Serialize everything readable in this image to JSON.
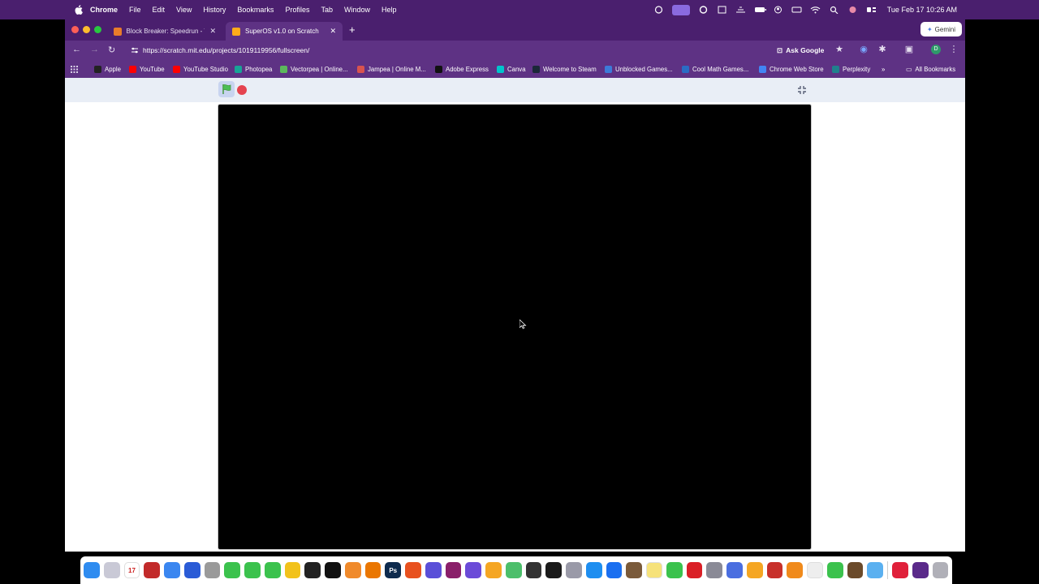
{
  "menubar": {
    "apple": "",
    "items": [
      "Chrome",
      "File",
      "Edit",
      "View",
      "History",
      "Bookmarks",
      "Profiles",
      "Tab",
      "Window",
      "Help"
    ],
    "clock": "Tue Feb 17  10:26 AM"
  },
  "browser": {
    "tabs": [
      {
        "title": "Block Breaker: Speedrun - Tu",
        "favicon_color": "#e87c2a"
      },
      {
        "title": "SuperOS v1.0 on Scratch",
        "favicon_color": "#ffab19"
      }
    ],
    "new_tab": "+",
    "gemini_label": "Gemini",
    "url": "https://scratch.mit.edu/projects/1019119956/fullscreen/",
    "ask_google": "Ask Google",
    "profile_initial": "D",
    "bookmarks": [
      {
        "label": "Apple",
        "color": "#222222"
      },
      {
        "label": "YouTube",
        "color": "#ff0000"
      },
      {
        "label": "YouTube Studio",
        "color": "#ff0000"
      },
      {
        "label": "Photopea",
        "color": "#18a497"
      },
      {
        "label": "Vectorpea | Online...",
        "color": "#5cb85c"
      },
      {
        "label": "Jampea | Online M...",
        "color": "#d9534f"
      },
      {
        "label": "Adobe Express",
        "color": "#111111"
      },
      {
        "label": "Canva",
        "color": "#00c4cc"
      },
      {
        "label": "Welcome to Steam",
        "color": "#1b2838"
      },
      {
        "label": "Unblocked Games...",
        "color": "#3d7bd9"
      },
      {
        "label": "Cool Math Games...",
        "color": "#2a6cc4"
      },
      {
        "label": "Chrome Web Store",
        "color": "#4285f4"
      },
      {
        "label": "Perplexity",
        "color": "#20808d"
      }
    ],
    "all_bookmarks": "All Bookmarks"
  },
  "scratch": {
    "green_flag": "green-flag-icon",
    "stop": "stop-icon",
    "exit_fullscreen": "exit-fullscreen-icon"
  },
  "dock": {
    "apps": [
      {
        "name": "Finder",
        "color": "#2f8cf0"
      },
      {
        "name": "Launchpad",
        "color": "#c9c9d6"
      },
      {
        "name": "Calendar",
        "color": "#ffffff",
        "label": "17"
      },
      {
        "name": "Notes",
        "color": "#c22a2a"
      },
      {
        "name": "Safari",
        "color": "#3a86f0"
      },
      {
        "name": "Xcode",
        "color": "#2a5bd6"
      },
      {
        "name": "Contacts",
        "color": "#9a9a9a"
      },
      {
        "name": "FaceTime",
        "color": "#3bc24d"
      },
      {
        "name": "Messages",
        "color": "#3bc24d"
      },
      {
        "name": "Phone",
        "color": "#3bc24d"
      },
      {
        "name": "Chrome",
        "color": "#f2c21b"
      },
      {
        "name": "ChatGPT",
        "color": "#222222"
      },
      {
        "name": "CapCut",
        "color": "#111111"
      },
      {
        "name": "Photos",
        "color": "#f08a2b"
      },
      {
        "name": "Blender",
        "color": "#ea7600"
      },
      {
        "name": "Photoshop",
        "color": "#0d2a4d",
        "label": "Ps"
      },
      {
        "name": "Office",
        "color": "#e8511f"
      },
      {
        "name": "iMovie",
        "color": "#5a4fd8"
      },
      {
        "name": "Affinity",
        "color": "#8a1f6a"
      },
      {
        "name": "Keynote",
        "color": "#6b4bd8"
      },
      {
        "name": "Pages",
        "color": "#f5a623"
      },
      {
        "name": "Maps",
        "color": "#4cbf6b"
      },
      {
        "name": "Activity Monitor",
        "color": "#333333"
      },
      {
        "name": "Audio",
        "color": "#1a1a1a"
      },
      {
        "name": "Disk Utility",
        "color": "#9a9aa8"
      },
      {
        "name": "App Store",
        "color": "#1e8ef0"
      },
      {
        "name": "QuickTime",
        "color": "#1a6ff0"
      },
      {
        "name": "Chess",
        "color": "#7a5a3a"
      },
      {
        "name": "Stickies",
        "color": "#f6e27a"
      },
      {
        "name": "Numbers",
        "color": "#3bc24d"
      },
      {
        "name": "Creative Cloud",
        "color": "#da1f26"
      },
      {
        "name": "System Settings",
        "color": "#8a8a96"
      },
      {
        "name": "Preview",
        "color": "#4a6ee0"
      },
      {
        "name": "Pencil",
        "color": "#f5a623"
      },
      {
        "name": "FileZilla",
        "color": "#c8302a"
      },
      {
        "name": "Books",
        "color": "#f08a1b"
      },
      {
        "name": "TextEdit",
        "color": "#eeeeee"
      },
      {
        "name": "Spotify",
        "color": "#3bc24d"
      },
      {
        "name": "Minecraft",
        "color": "#6b4a2a"
      },
      {
        "name": "Files",
        "color": "#5ab0f0"
      },
      {
        "name": "YouTube",
        "color": "#e0203a"
      },
      {
        "name": "Screen Recording",
        "color": "#5a2a8a"
      },
      {
        "name": "Trash",
        "color": "#b0b0b8"
      }
    ]
  }
}
